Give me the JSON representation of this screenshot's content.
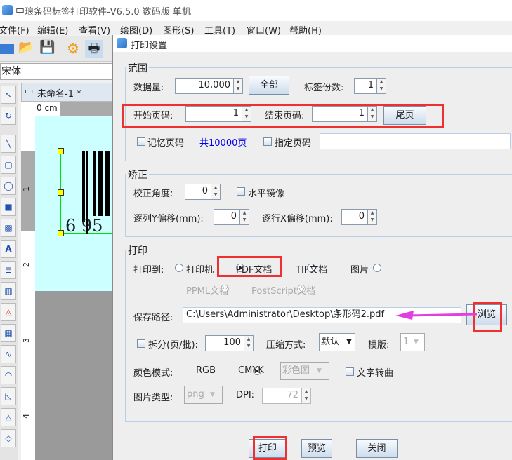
{
  "app": {
    "title": "中琅条码标签打印软件-V6.5.0 数码版 单机"
  },
  "menu": [
    "文件(F)",
    "编辑(E)",
    "查看(V)",
    "绘图(D)",
    "图形(S)",
    "工具(T)",
    "窗口(W)",
    "帮助(H)"
  ],
  "toolbar": {
    "font": "宋体"
  },
  "document": {
    "tab": "未命名-1 *",
    "ruler_unit": "0 cm",
    "ruler_v": [
      "1",
      "2",
      "3",
      "4"
    ],
    "barcode_digits": "6 95"
  },
  "dialog": {
    "title": "打印设置",
    "range": {
      "label": "范围",
      "data_count_label": "数据量:",
      "data_count": "10,000",
      "all_button": "全部",
      "copies_label": "标签份数:",
      "copies": "1",
      "start_label": "开始页码:",
      "start": "1",
      "end_label": "结束页码:",
      "end": "1",
      "last_button": "尾页",
      "remember_label": "记忆页码",
      "total": "共10000页",
      "specify_label": "指定页码",
      "specify_value": ""
    },
    "correction": {
      "label": "矫正",
      "angle_label": "校正角度:",
      "angle": "0",
      "mirror_label": "水平镜像",
      "y_offset_label": "逐列Y偏移(mm):",
      "y_offset": "0",
      "x_offset_label": "逐行X偏移(mm):",
      "x_offset": "0"
    },
    "print": {
      "label": "打印",
      "print_to_label": "打印到:",
      "options": [
        "打印机",
        "PDF文档",
        "TIF文档",
        "图片"
      ],
      "disabled_options": [
        "PPML文档",
        "PostScript文档"
      ],
      "selected": "PDF文档",
      "save_path_label": "保存路径:",
      "save_path": "C:\\Users\\Administrator\\Desktop\\条形码2.pdf",
      "browse_button": "浏览",
      "split_label": "拆分(页/批):",
      "split": "100",
      "compress_label": "压缩方式:",
      "compress": "默认",
      "template_label": "模版:",
      "template": "1",
      "color_mode_label": "颜色模式:",
      "color_modes": [
        "RGB",
        "CMYK"
      ],
      "color_mode": "RGB",
      "color_combo": "彩色图",
      "text_curve_label": "文字转曲",
      "image_type_label": "图片类型:",
      "image_type": "png",
      "dpi_label": "DPI:",
      "dpi": "72"
    },
    "buttons": {
      "print": "打印",
      "preview": "预览",
      "close": "关闭"
    }
  },
  "colors": {
    "highlight": "#f03030",
    "arrow": "#e040e0",
    "link": "#0000ee",
    "canvas": "#ccffff"
  }
}
